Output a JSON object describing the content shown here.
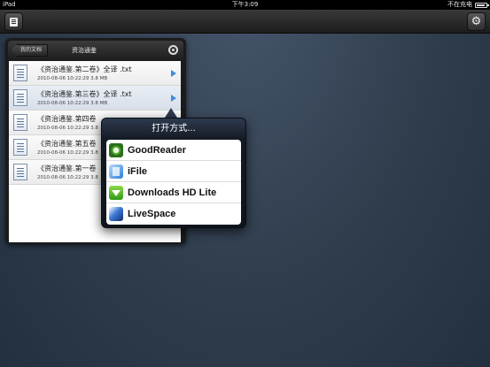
{
  "status_bar": {
    "device": "iPad",
    "time": "下午3:09",
    "battery": "不在充电"
  },
  "panel": {
    "back_label": "我的文档",
    "title": "资治通鉴",
    "files": [
      {
        "name": "《资治通鉴.第二卷》全译 .txt",
        "meta": "2010-08-06 10:22:29 3.8 MB"
      },
      {
        "name": "《资治通鉴.第三卷》全译 .txt",
        "meta": "2010-08-06 10:22:29 3.8 MB"
      },
      {
        "name": "《资治通鉴.第四卷",
        "meta": "2010-08-06 10:22:29 3.8"
      },
      {
        "name": "《资治通鉴.第五卷",
        "meta": "2010-08-06 10:22:29 3.8"
      },
      {
        "name": "《资治通鉴.第一卷",
        "meta": "2010-08-06 10:22:29 3.8"
      }
    ]
  },
  "popover": {
    "title": "打开方式...",
    "apps": [
      {
        "label": "GoodReader",
        "icon": "goodreader-icon"
      },
      {
        "label": "iFile",
        "icon": "ifile-icon"
      },
      {
        "label": "Downloads HD Lite",
        "icon": "downloads-icon"
      },
      {
        "label": "LiveSpace",
        "icon": "livespace-icon"
      }
    ]
  },
  "colors": {
    "background": "#2f3d4c",
    "accent_arrow": "#3d8de0",
    "popover_header": "#2d3a4e"
  }
}
